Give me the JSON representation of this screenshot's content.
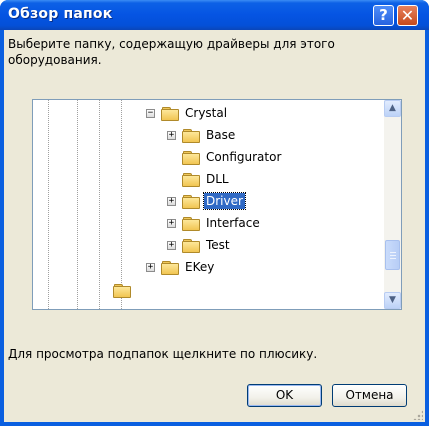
{
  "window": {
    "title": "Обзор папок",
    "help_glyph": "?",
    "close_glyph": "✕"
  },
  "prompt": "Выберите папку, содержащую драйверы для этого оборудования.",
  "tree": {
    "nodes": [
      {
        "label": "Crystal",
        "expander": "−",
        "selected": false
      },
      {
        "label": "Base",
        "expander": "+",
        "selected": false
      },
      {
        "label": "Configurator",
        "expander": "",
        "selected": false
      },
      {
        "label": "DLL",
        "expander": "",
        "selected": false
      },
      {
        "label": "Driver",
        "expander": "+",
        "selected": true
      },
      {
        "label": "Interface",
        "expander": "+",
        "selected": false
      },
      {
        "label": "Test",
        "expander": "+",
        "selected": false
      },
      {
        "label": "EKey",
        "expander": "+",
        "selected": false
      }
    ],
    "scroll_up_glyph": "▲",
    "scroll_down_glyph": "▼",
    "scroll_position": 0.7
  },
  "hint": "Для просмотра подпапок щелкните по плюсику.",
  "buttons": {
    "ok": "OK",
    "cancel": "Отмена"
  },
  "colors": {
    "title_bar": "#0554e3",
    "selection": "#316ac5",
    "dialog_face": "#ece9d8"
  }
}
